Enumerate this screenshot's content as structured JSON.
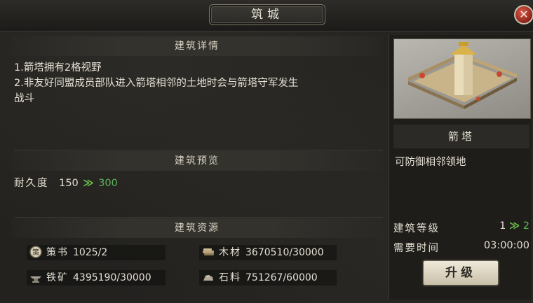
{
  "window": {
    "title": "筑城",
    "close_symbol": "✕"
  },
  "details": {
    "header": "建筑详情",
    "lines": [
      "1.箭塔拥有2格视野",
      "2.非友好同盟成员部队进入箭塔相邻的土地时会与箭塔守军发生",
      "战斗"
    ]
  },
  "preview": {
    "header": "建筑预览",
    "durability_label": "耐久度",
    "durability_current": "150",
    "durability_next": "300",
    "arrow": "≫"
  },
  "resources": {
    "header": "建筑资源",
    "items": [
      {
        "icon": "strategy-book-icon",
        "icon_text": "策",
        "name": "策书",
        "value": "1025/2"
      },
      {
        "icon": "wood-icon",
        "name": "木材",
        "value": "3670510/30000"
      },
      {
        "icon": "iron-ore-icon",
        "name": "铁矿",
        "value": "4395190/30000"
      },
      {
        "icon": "stone-icon",
        "name": "石料",
        "value": "751267/60000"
      }
    ]
  },
  "building": {
    "name": "箭塔",
    "effect": "可防御相邻领地",
    "level_label": "建筑等级",
    "level_current": "1",
    "level_next": "2",
    "level_arrow": "≫",
    "time_label": "需要时间",
    "time_value": "03:00:00",
    "upgrade_label": "升级"
  },
  "colors": {
    "accent_green": "#5fb35a",
    "close_red": "#8e2318",
    "button_face": "#efe9da"
  }
}
